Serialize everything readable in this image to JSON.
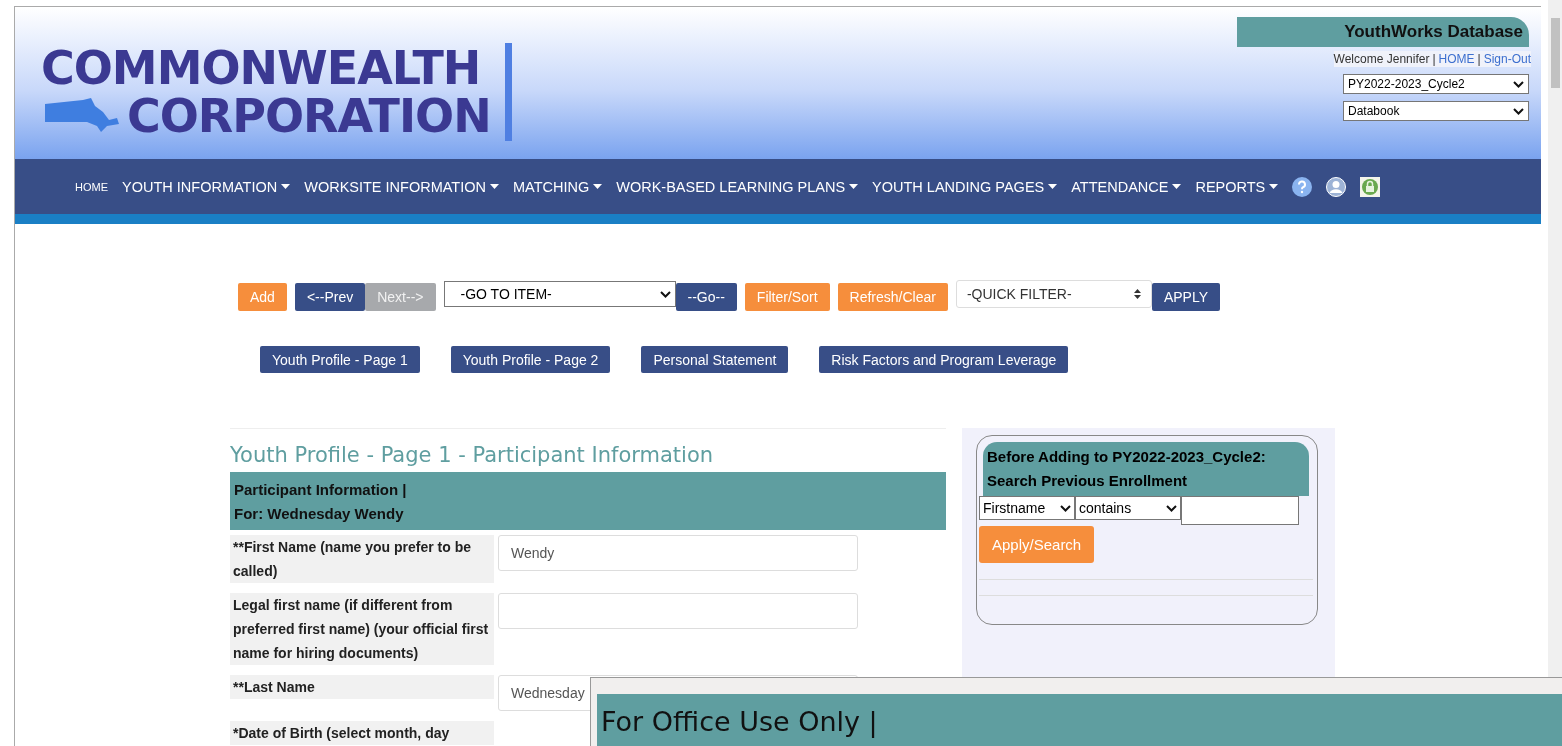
{
  "logo": {
    "line_1": "COMMONWEALTH",
    "line_2": "CORPORATION"
  },
  "app_title": "YouthWorks Database",
  "user_bar": [
    {
      "kind": "text",
      "label": "Welcome Jennifer"
    },
    {
      "kind": "sep",
      "label": "|"
    },
    {
      "kind": "link",
      "label": "HOME"
    },
    {
      "kind": "sep",
      "label": "|"
    },
    {
      "kind": "link",
      "label": "Sign-Out"
    }
  ],
  "header_selects": [
    "PY2022-2023_Cycle2",
    "Databook"
  ],
  "nav": [
    {
      "label": "HOME",
      "kind": "small"
    },
    {
      "label": "YOUTH INFORMATION",
      "kind": "menu"
    },
    {
      "label": "WORKSITE INFORMATION",
      "kind": "menu"
    },
    {
      "label": "MATCHING",
      "kind": "menu"
    },
    {
      "label": "WORK-BASED LEARNING PLANS",
      "kind": "menu"
    },
    {
      "label": "YOUTH LANDING PAGES",
      "kind": "menu"
    },
    {
      "label": "ATTENDANCE",
      "kind": "menu"
    },
    {
      "label": "REPORTS",
      "kind": "menu"
    },
    {
      "kind": "help"
    },
    {
      "kind": "user"
    },
    {
      "kind": "badge"
    }
  ],
  "toolbar": [
    {
      "kind": "button",
      "label": "Add",
      "color": "#f68e3c",
      "disabled": false,
      "joined": false
    },
    {
      "kind": "button",
      "label": "<--Prev",
      "color": "#374e87",
      "disabled": false,
      "joined": false
    },
    {
      "kind": "button",
      "label": "Next-->",
      "color": "#a7a9ac",
      "disabled": true,
      "joined": true
    },
    {
      "kind": "select",
      "label": "-GO TO ITEM-"
    },
    {
      "kind": "button",
      "label": "--Go--",
      "color": "#374e87",
      "disabled": false,
      "joined": true
    },
    {
      "kind": "button",
      "label": "Filter/Sort",
      "color": "#f68e3c",
      "disabled": false,
      "joined": false
    },
    {
      "kind": "button",
      "label": "Refresh/Clear",
      "color": "#f68e3c",
      "disabled": false,
      "joined": false
    },
    {
      "kind": "spinner",
      "label": "-QUICK FILTER-"
    },
    {
      "kind": "button",
      "label": "APPLY",
      "color": "#374e87",
      "disabled": false,
      "joined": true
    }
  ],
  "page_tabs": [
    "Youth Profile - Page 1",
    "Youth Profile - Page 2",
    "Personal Statement",
    "Risk Factors and Program Leverage"
  ],
  "form": {
    "title": "Youth Profile - Page 1 - Participant Information",
    "section_line_1": "Participant Information |",
    "section_line_2": "For: Wednesday Wendy",
    "fields": [
      {
        "kind": "input",
        "label": "**First Name (name you prefer to be called)",
        "value": "Wendy"
      },
      {
        "kind": "input",
        "label": "Legal first name (if different from preferred first name) (your official first name for hiring documents)"
      },
      {
        "kind": "input",
        "label": "**Last Name",
        "value": "Wednesday"
      },
      {
        "kind": "label",
        "label": "*Date of Birth (select month, day"
      }
    ]
  },
  "search_panel": {
    "title_line_1": "Before Adding to PY2022-2023_Cycle2:",
    "title_line_2": "Search Previous Enrollment",
    "field": "Firstname",
    "operator": "contains",
    "button": "Apply/Search"
  },
  "popup": {
    "title": "For Office Use Only |"
  }
}
